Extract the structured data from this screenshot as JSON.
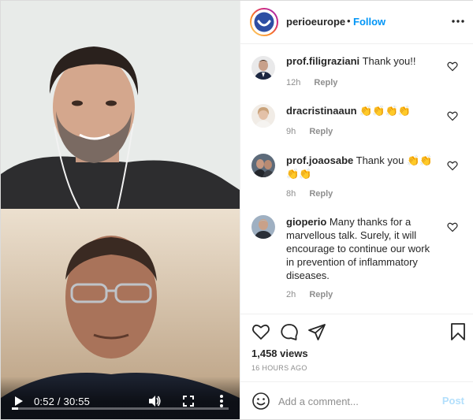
{
  "video": {
    "time": "0:52 / 30:55",
    "progress": 0.028,
    "play_icon": "play-icon",
    "volume_icon": "volume-icon",
    "fullscreen_icon": "fullscreen-icon",
    "more_icon": "more-vertical-icon"
  },
  "header": {
    "username": "perioeurope",
    "separator": "•",
    "follow_label": "Follow"
  },
  "comments": [
    {
      "user": "prof.filigraziani",
      "text": "Thank you!!",
      "time": "12h",
      "reply": "Reply"
    },
    {
      "user": "dracristinaaun",
      "text": "👏👏👏👏",
      "time": "9h",
      "reply": "Reply"
    },
    {
      "user": "prof.joaosabe",
      "text": "Thank you 👏👏 👏👏",
      "time": "8h",
      "reply": "Reply"
    },
    {
      "user": "gioperio",
      "text": "Many thanks for a marvellous talk. Surely, it will encourage to continue our work in prevention of inflammatory diseases.",
      "time": "2h",
      "reply": "Reply"
    }
  ],
  "stats": {
    "views": "1,458 views",
    "time_ago": "16 HOURS AGO"
  },
  "composer": {
    "placeholder": "Add a comment...",
    "post_label": "Post"
  },
  "colors": {
    "accent": "#0095f6",
    "post_disabled": "#b2dffc",
    "muted": "#8e8e8e"
  }
}
